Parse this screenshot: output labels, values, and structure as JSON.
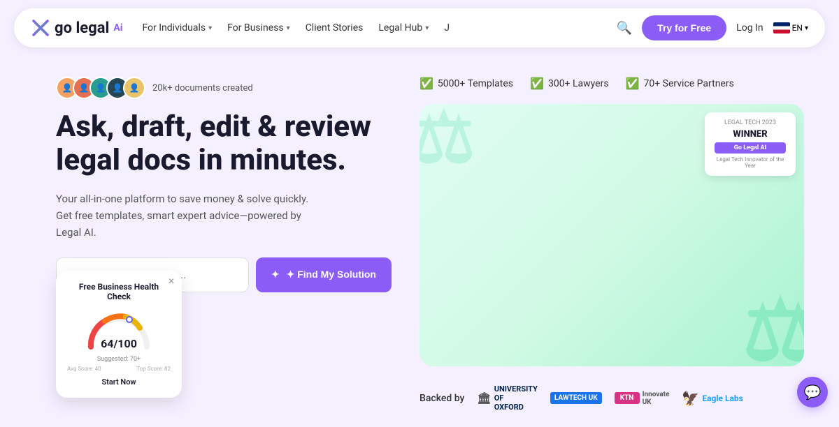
{
  "navbar": {
    "logo_text": "go legal",
    "logo_ai": "Ai",
    "nav_items": [
      {
        "label": "For Individuals",
        "has_dropdown": true
      },
      {
        "label": "For Business",
        "has_dropdown": true
      },
      {
        "label": "Client Stories",
        "has_dropdown": false
      },
      {
        "label": "Legal Hub",
        "has_dropdown": true
      },
      {
        "label": "J",
        "has_dropdown": false
      }
    ],
    "try_btn": "Try for Free",
    "login": "Log In",
    "lang": "EN"
  },
  "hero": {
    "avatars_label": "20k+ documents created",
    "title": "Ask, draft, edit & review legal docs in minutes.",
    "subtitle": "Your all-in-one platform to save money & solve quickly. Get free templates, smart expert advice—powered by Legal AI.",
    "search_placeholder": "",
    "find_btn": "✦ Find My Solution"
  },
  "stats": {
    "items": [
      {
        "icon": "✅",
        "label": "5000+ Templates"
      },
      {
        "icon": "✅",
        "label": "300+ Lawyers"
      },
      {
        "icon": "✅",
        "label": "70+ Service Partners"
      }
    ]
  },
  "winner_badge": {
    "seal_text": "LEGAL TECH 2023",
    "title": "WINNER",
    "brand": "Go Legal AI",
    "subtitle": "Legal Tech Innovator of the Year"
  },
  "health_card": {
    "title": "Free Business Health Check",
    "score": "64/100",
    "score_sub": "Suggested: 70+",
    "label_bad": "Avg Score: 40",
    "label_good": "Top Score: 82",
    "start_now": "Start Now"
  },
  "backed_by": {
    "label": "Backed by",
    "backers": [
      {
        "name": "Oxford",
        "type": "oxford"
      },
      {
        "name": "LAWTECH UK",
        "type": "lawtech"
      },
      {
        "name": "KTN",
        "type": "ktn"
      },
      {
        "name": "Innovate UK",
        "type": "innovate"
      },
      {
        "name": "Eagle Labs",
        "type": "eagle"
      }
    ]
  },
  "chat_btn": "💬"
}
